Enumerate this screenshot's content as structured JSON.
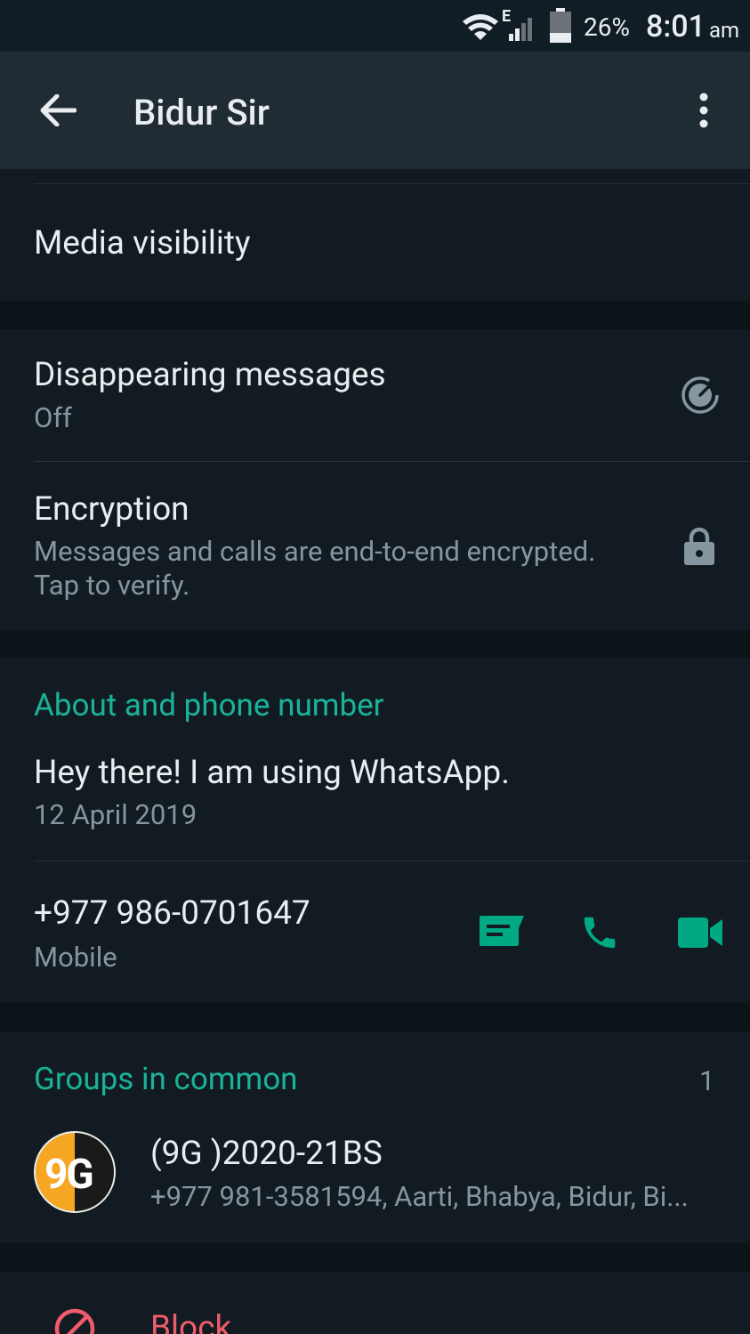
{
  "status_bar": {
    "network": "E",
    "battery": "26%",
    "time": "8:01",
    "ampm": "am"
  },
  "app_bar": {
    "title": "Bidur Sir"
  },
  "media": {
    "label": "Media visibility"
  },
  "disappearing": {
    "title": "Disappearing messages",
    "value": "Off"
  },
  "encryption": {
    "title": "Encryption",
    "line1": "Messages and calls are end-to-end encrypted.",
    "line2": "Tap to verify."
  },
  "about": {
    "header": "About and phone number",
    "status": "Hey there! I am using WhatsApp.",
    "date": "12 April 2019",
    "phone": "+977 986-0701647",
    "phone_type": "Mobile"
  },
  "groups": {
    "header": "Groups in common",
    "count": "1",
    "items": [
      {
        "avatar_text": "9G",
        "name": "(9G )2020-21BS",
        "members": "+977 981-3581594, Aarti, Bhabya, Bidur, Bi..."
      }
    ]
  },
  "block": {
    "label": "Block"
  },
  "colors": {
    "accent": "#00a884",
    "danger": "#f15c6d",
    "background": "#111b21"
  }
}
